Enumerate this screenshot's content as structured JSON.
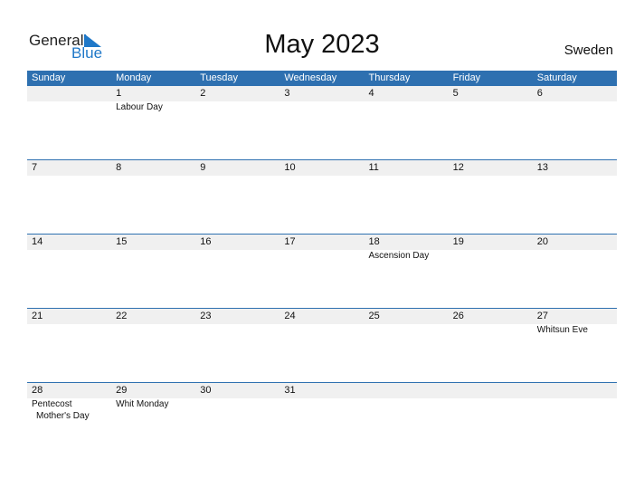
{
  "logo": {
    "general": "General",
    "blue": "Blue"
  },
  "title": "May 2023",
  "country": "Sweden",
  "colors": {
    "header_bg": "#2e70b0",
    "date_strip": "#f0f0f0",
    "logo_blue": "#1f78c8"
  },
  "weekdays": [
    "Sunday",
    "Monday",
    "Tuesday",
    "Wednesday",
    "Thursday",
    "Friday",
    "Saturday"
  ],
  "weeks": [
    [
      {
        "day": ""
      },
      {
        "day": "1",
        "events": [
          "Labour Day"
        ]
      },
      {
        "day": "2"
      },
      {
        "day": "3"
      },
      {
        "day": "4"
      },
      {
        "day": "5"
      },
      {
        "day": "6"
      }
    ],
    [
      {
        "day": "7"
      },
      {
        "day": "8"
      },
      {
        "day": "9"
      },
      {
        "day": "10"
      },
      {
        "day": "11"
      },
      {
        "day": "12"
      },
      {
        "day": "13"
      }
    ],
    [
      {
        "day": "14"
      },
      {
        "day": "15"
      },
      {
        "day": "16"
      },
      {
        "day": "17"
      },
      {
        "day": "18",
        "events": [
          "Ascension Day"
        ]
      },
      {
        "day": "19"
      },
      {
        "day": "20"
      }
    ],
    [
      {
        "day": "21"
      },
      {
        "day": "22"
      },
      {
        "day": "23"
      },
      {
        "day": "24"
      },
      {
        "day": "25"
      },
      {
        "day": "26"
      },
      {
        "day": "27",
        "events": [
          "Whitsun Eve"
        ]
      }
    ],
    [
      {
        "day": "28",
        "events": [
          "Pentecost",
          "Mother's Day"
        ]
      },
      {
        "day": "29",
        "events": [
          "Whit Monday"
        ]
      },
      {
        "day": "30"
      },
      {
        "day": "31"
      },
      {
        "day": ""
      },
      {
        "day": ""
      },
      {
        "day": ""
      }
    ]
  ]
}
